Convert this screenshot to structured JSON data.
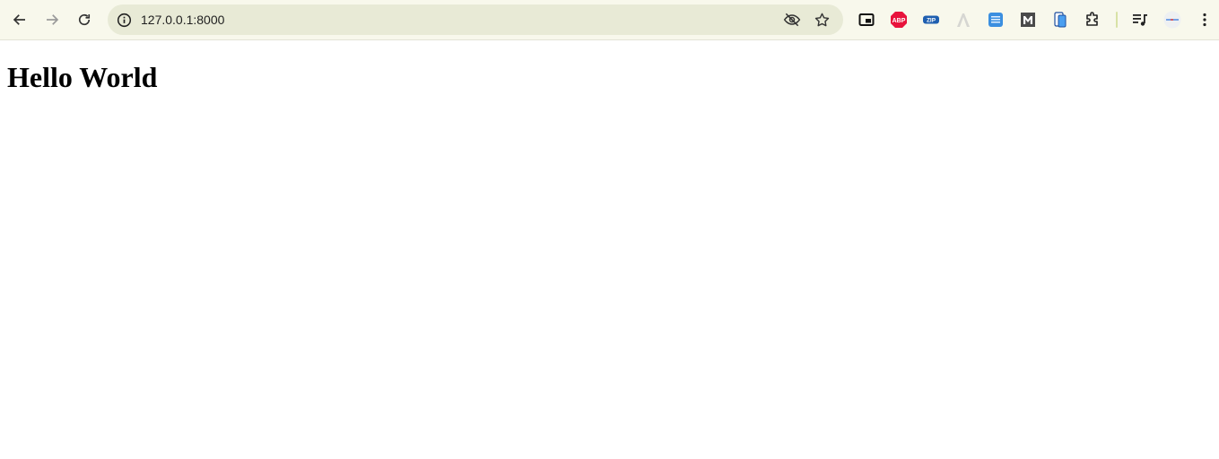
{
  "browser": {
    "address_bar": {
      "url": "127.0.0.1:8000",
      "site_info_icon": "info-icon",
      "tracking_icon": "eye-off-icon",
      "bookmark_icon": "star-icon"
    },
    "nav": {
      "back_icon": "arrow-left-icon",
      "forward_icon": "arrow-right-icon",
      "reload_icon": "reload-icon"
    },
    "extensions": [
      {
        "name": "picture-in-picture",
        "icon": "pip-icon"
      },
      {
        "name": "adblock-plus",
        "icon": "abp-icon",
        "label": "ABP",
        "color": "#e8133c"
      },
      {
        "name": "zip",
        "icon": "zip-icon",
        "label": "ZIP",
        "color": "#1f5fb0"
      },
      {
        "name": "extension-a",
        "icon": "a-logo-icon"
      },
      {
        "name": "keyboard-extension",
        "icon": "keyboard-icon",
        "color": "#3b8fe0"
      },
      {
        "name": "m-extension",
        "icon": "m-logo-icon",
        "label": "M",
        "color": "#4a4a4a"
      },
      {
        "name": "device-extension",
        "icon": "phone-icon",
        "color": "#3b8fe0"
      },
      {
        "name": "extensions-menu",
        "icon": "puzzle-icon"
      }
    ],
    "media_icon": "media-control-icon",
    "profile_icon": "profile-avatar-icon",
    "menu_icon": "kebab-menu-icon"
  },
  "page": {
    "heading": "Hello World"
  }
}
